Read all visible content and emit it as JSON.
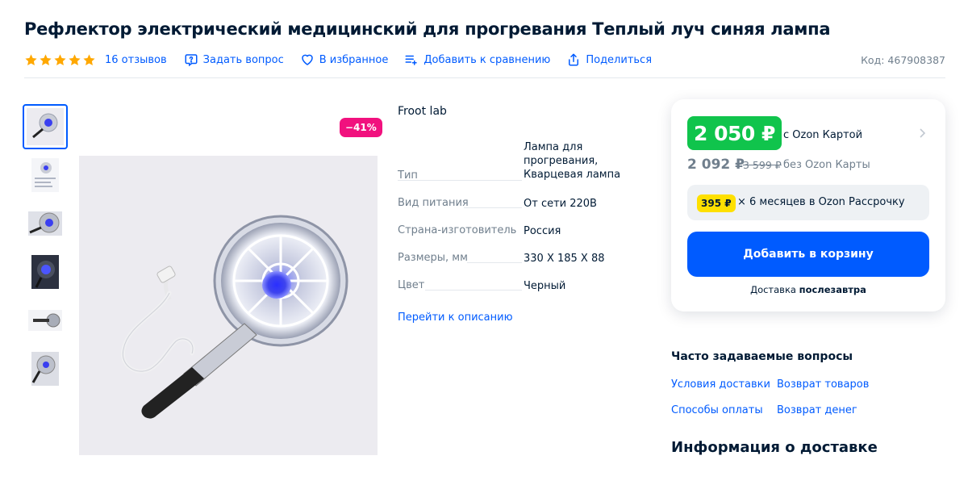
{
  "product": {
    "title": "Рефлектор электрический медицинский для прогревания Теплый луч синяя лампа",
    "rating_stars": 5,
    "reviews": "16 отзывов",
    "code": "Код: 467908387",
    "brand": "Froot lab",
    "discount": "−41%"
  },
  "actions": {
    "ask": "Задать вопрос",
    "favorite": "В избранное",
    "compare": "Добавить к сравнению",
    "share": "Поделиться"
  },
  "specs": [
    {
      "key": "Тип",
      "value": "Лампа для прогревания, Кварцевая лампа"
    },
    {
      "key": "Вид питания",
      "value": "От сети 220В"
    },
    {
      "key": "Страна-изготовитель",
      "value": "Россия"
    },
    {
      "key": "Размеры, мм",
      "value": "330 X 185 X 88"
    },
    {
      "key": "Цвет",
      "value": "Черный"
    }
  ],
  "to_description": "Перейти к описанию",
  "price": {
    "card_price": "2 050 ₽",
    "card_caption": "с Ozon Картой",
    "regular_price": "2 092 ₽",
    "old_price": "3 599 ₽",
    "regular_caption": "без Ozon Карты",
    "installment_amount": "395 ₽",
    "installment_text": "× 6 месяцев в Ozon Рассрочку",
    "cart_button": "Добавить в корзину",
    "delivery_prefix": "Доставка",
    "delivery_when": "послезавтра"
  },
  "faq": {
    "title": "Часто задаваемые вопросы",
    "links": [
      "Условия доставки",
      "Возврат товаров",
      "Способы оплаты",
      "Возврат денег"
    ]
  },
  "delivery_info_title": "Информация о доставке",
  "colors": {
    "accent": "#005bff",
    "price_green": "#10c44c",
    "discount": "#f1117e",
    "installment_badge": "#fee000",
    "star": "#ffa800"
  }
}
